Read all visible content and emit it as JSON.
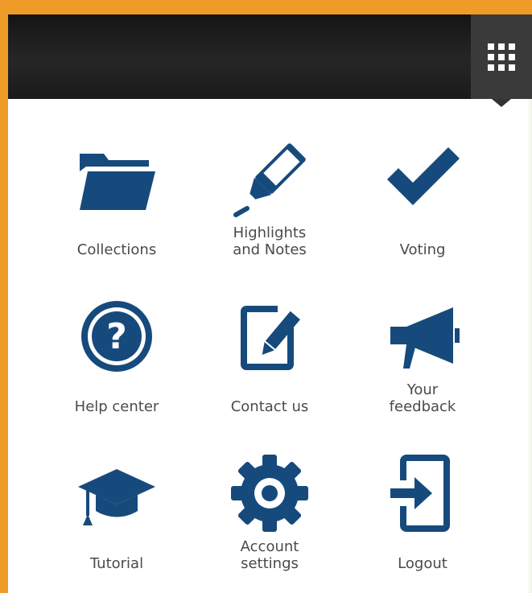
{
  "menu": {
    "apps_button_icon": "grid-icon",
    "accent_color": "#ee9b27",
    "icon_color": "#174a7c",
    "items": [
      {
        "label": "Collections",
        "icon": "folder-icon"
      },
      {
        "label": "Highlights\nand Notes",
        "icon": "marker-icon"
      },
      {
        "label": "Voting",
        "icon": "checkmark-icon"
      },
      {
        "label": "Help center",
        "icon": "help-icon"
      },
      {
        "label": "Contact us",
        "icon": "edit-icon"
      },
      {
        "label": "Your\nfeedback",
        "icon": "megaphone-icon"
      },
      {
        "label": "Tutorial",
        "icon": "graduation-cap-icon"
      },
      {
        "label": "Account\nsettings",
        "icon": "gear-icon"
      },
      {
        "label": "Logout",
        "icon": "logout-icon"
      }
    ]
  }
}
